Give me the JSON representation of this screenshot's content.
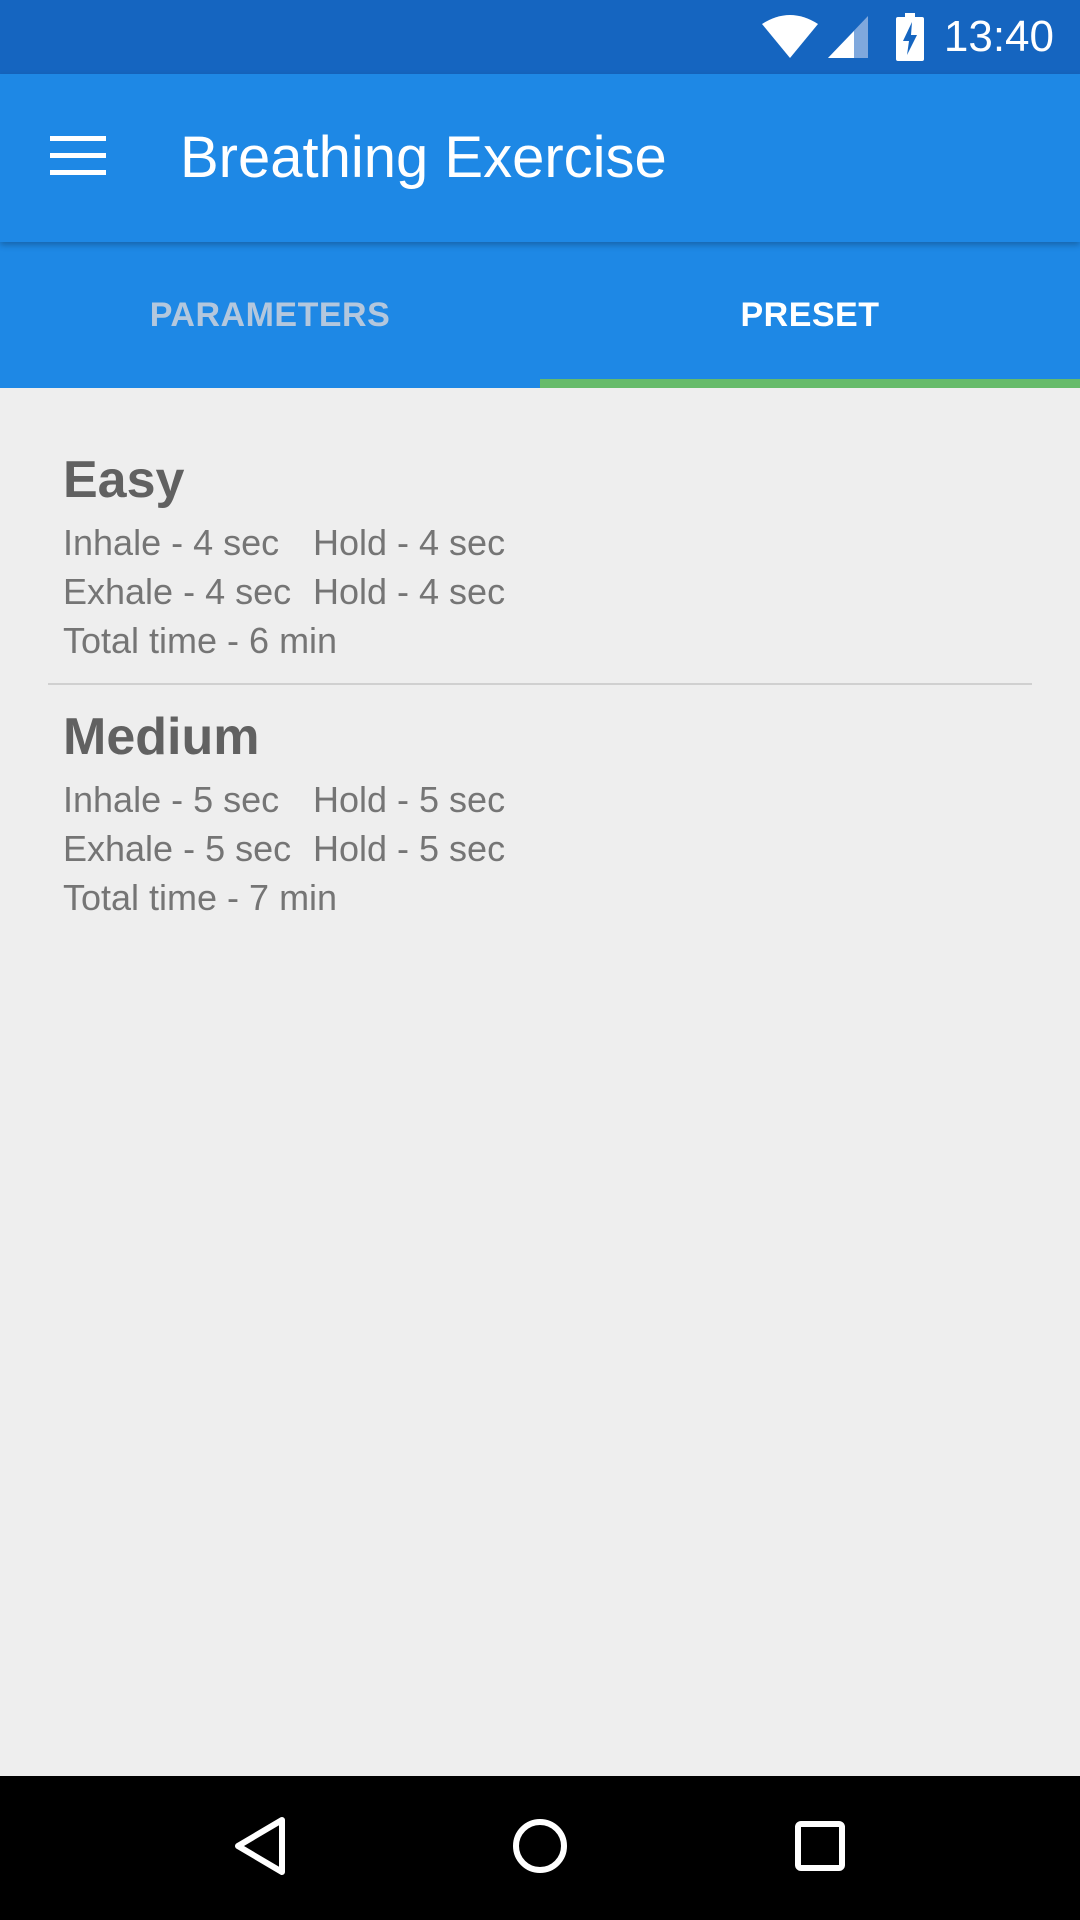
{
  "status_bar": {
    "time": "13:40",
    "icons": [
      "wifi-icon",
      "cell-signal-icon",
      "battery-charging-icon"
    ]
  },
  "app_bar": {
    "title": "Breathing Exercise",
    "menu_icon": "hamburger-menu-icon",
    "background_color": "#1E88E5"
  },
  "tabs": [
    {
      "label": "PARAMETERS",
      "active": false
    },
    {
      "label": "PRESET",
      "active": true
    }
  ],
  "presets": [
    {
      "name": "Easy",
      "inhale": "Inhale - 4 sec",
      "hold1": "Hold - 4 sec",
      "exhale": "Exhale - 4 sec",
      "hold2": "Hold - 4 sec",
      "total": "Total time - 6 min"
    },
    {
      "name": "Medium",
      "inhale": "Inhale - 5 sec",
      "hold1": "Hold - 5 sec",
      "exhale": "Exhale - 5 sec",
      "hold2": "Hold - 5 sec",
      "total": "Total time - 7 min"
    }
  ],
  "nav_bar": {
    "icons": [
      "back-icon",
      "home-icon",
      "recents-icon"
    ]
  },
  "colors": {
    "status_bar": "#1565C0",
    "primary": "#1E88E5",
    "tab_indicator": "#66BB6A",
    "background": "#EEEEEE"
  }
}
